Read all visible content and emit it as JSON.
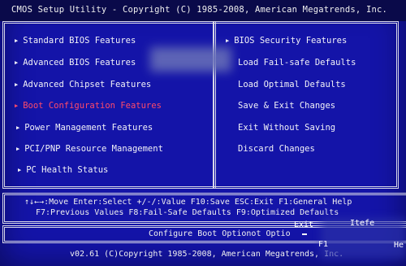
{
  "title": "CMOS Setup Utility - Copyright (C) 1985-2008, American Megatrends, Inc.",
  "left_menu": [
    {
      "label": "Standard BIOS Features",
      "selected": false
    },
    {
      "label": "Advanced BIOS Features",
      "selected": false
    },
    {
      "label": "Advanced Chipset Features",
      "selected": false
    },
    {
      "label": "Boot Configuration Features",
      "selected": true
    },
    {
      "label": "Power Management Features",
      "selected": false
    },
    {
      "label": "PCI/PNP Resource Management",
      "selected": false
    },
    {
      "label": "PC Health Status",
      "selected": false
    }
  ],
  "right_menu": [
    {
      "label": "BIOS Security Features",
      "has_arrow": true
    },
    {
      "label": "Load Fail-safe Defaults",
      "has_arrow": false
    },
    {
      "label": "Load Optimal Defaults",
      "has_arrow": false
    },
    {
      "label": "Save & Exit Changes",
      "has_arrow": false
    },
    {
      "label": "Exit Without Saving",
      "has_arrow": false
    },
    {
      "label": "Discard Changes",
      "has_arrow": false
    }
  ],
  "help": {
    "line1": "↑↓←→:Move  Enter:Select  +/-/:Value  F10:Save  ESC:Exit  F1:General Help",
    "line2": "F7:Previous Values    F8:Fail-Safe Defaults    F9:Optimized Defaults"
  },
  "description": "Configure Boot Optionot Optio",
  "footer": "v02.61 (C)Copyright 1985-2008, American Megatrends, Inc.",
  "popup": {
    "exit": "Exit",
    "itefe": "Itefe",
    "f1": "F1",
    "help": "He"
  },
  "colors": {
    "background": "#1414a8",
    "title_bar": "#0a0a4a",
    "highlight": "#ff4a6a",
    "text": "#f2f2f8"
  },
  "icons": {
    "menu_marker": "triangle-right-icon"
  }
}
